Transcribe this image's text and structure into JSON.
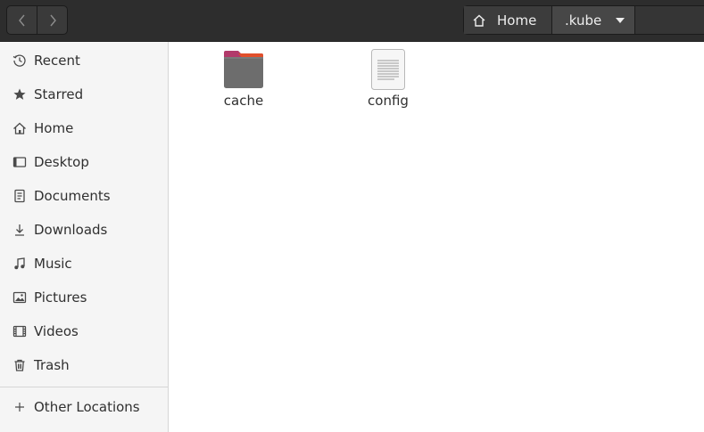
{
  "toolbar": {
    "back_icon": "chevron-left-icon",
    "forward_icon": "chevron-right-icon"
  },
  "pathbar": {
    "home_label": "Home",
    "current_label": ".kube"
  },
  "sidebar": {
    "items": [
      {
        "label": "Recent",
        "icon": "clock-icon"
      },
      {
        "label": "Starred",
        "icon": "star-icon"
      },
      {
        "label": "Home",
        "icon": "home-icon"
      },
      {
        "label": "Desktop",
        "icon": "desktop-icon"
      },
      {
        "label": "Documents",
        "icon": "document-icon"
      },
      {
        "label": "Downloads",
        "icon": "download-icon"
      },
      {
        "label": "Music",
        "icon": "music-icon"
      },
      {
        "label": "Pictures",
        "icon": "picture-icon"
      },
      {
        "label": "Videos",
        "icon": "video-icon"
      },
      {
        "label": "Trash",
        "icon": "trash-icon"
      }
    ],
    "other_locations": {
      "label": "Other Locations",
      "icon": "plus-icon"
    }
  },
  "files": [
    {
      "name": "cache",
      "type": "folder"
    },
    {
      "name": "config",
      "type": "text-file"
    }
  ],
  "colors": {
    "header_bg": "#2d2d2d",
    "sidebar_bg": "#f5f5f5",
    "folder_accent": "#b23a6b",
    "folder_tab_accent": "#e95420"
  }
}
